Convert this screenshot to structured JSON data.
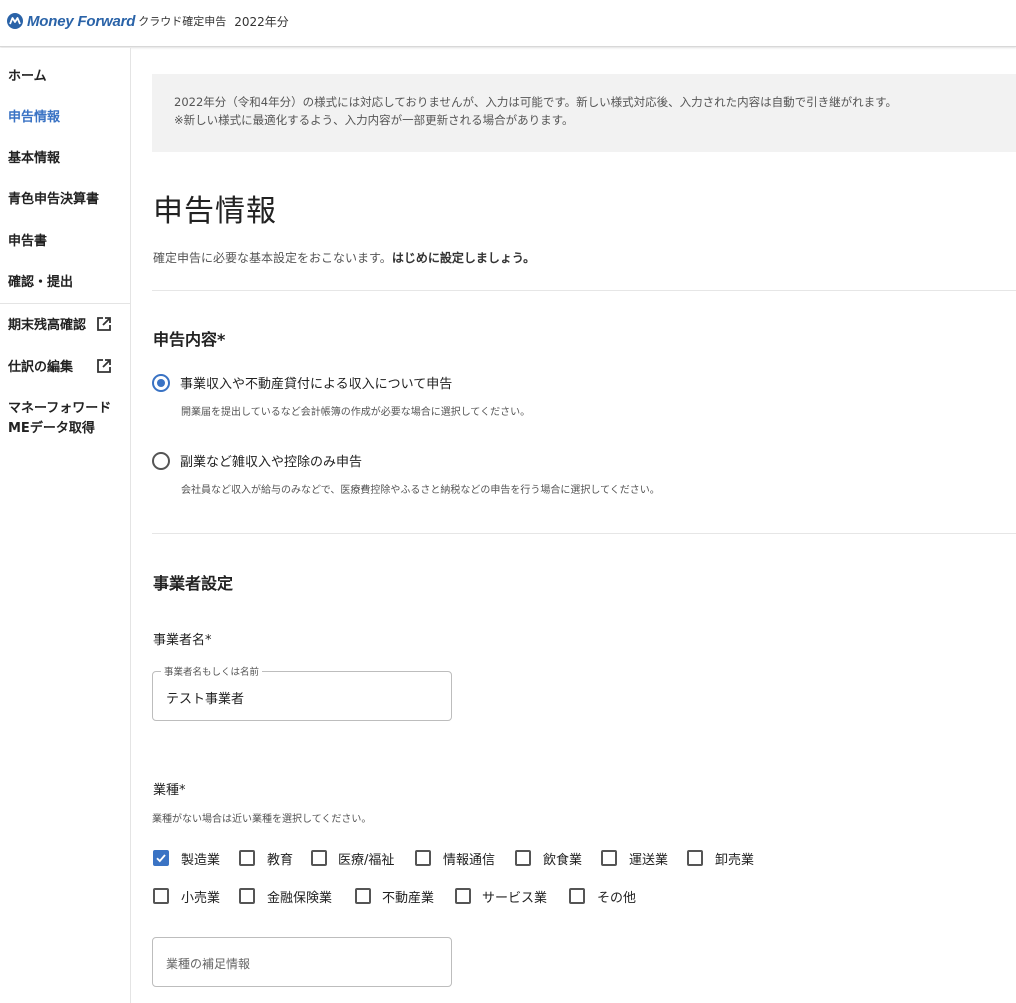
{
  "header": {
    "brand": "Money Forward",
    "product": "クラウド確定申告",
    "year": "2022年分"
  },
  "sidebar": {
    "items": [
      {
        "label": "ホーム"
      },
      {
        "label": "申告情報"
      },
      {
        "label": "基本情報"
      },
      {
        "label": "青色申告決算書"
      },
      {
        "label": "申告書"
      },
      {
        "label": "確認・提出"
      }
    ],
    "external_items": [
      {
        "label": "期末残高確認"
      },
      {
        "label": "仕訳の編集"
      }
    ],
    "import_line1": "マネーフォワード",
    "import_line2": "MEデータ取得"
  },
  "notice": {
    "line1": "2022年分（令和4年分）の様式には対応しておりませんが、入力は可能です。新しい様式対応後、入力された内容は自動で引き継がれます。",
    "line2": "※新しい様式に最適化するよう、入力内容が一部更新される場合があります。"
  },
  "page": {
    "title": "申告情報",
    "desc_plain": "確定申告に必要な基本設定をおこないます。",
    "desc_bold": "はじめに設定しましょう。"
  },
  "declaration": {
    "title": "申告内容*",
    "options": [
      {
        "label": "事業収入や不動産貸付による収入について申告",
        "desc": "開業届を提出しているなど会計帳簿の作成が必要な場合に選択してください。"
      },
      {
        "label": "副業など雑収入や控除のみ申告",
        "desc": "会社員など収入が給与のみなどで、医療費控除やふるさと納税などの申告を行う場合に選択してください。"
      }
    ]
  },
  "business": {
    "title": "事業者設定",
    "name_label": "事業者名*",
    "name_legend": "事業者名もしくは名前",
    "name_value": "テスト事業者",
    "industry_label": "業種*",
    "industry_hint": "業種がない場合は近い業種を選択してください。",
    "industries": [
      "製造業",
      "教育",
      "医療/福祉",
      "情報通信",
      "飲食業",
      "運送業",
      "卸売業",
      "小売業",
      "金融保険業",
      "不動産業",
      "サービス業",
      "その他"
    ],
    "supplement_placeholder": "業種の補足情報"
  },
  "colors": {
    "accent": "#3a73c4",
    "brand": "#2a63a8"
  }
}
